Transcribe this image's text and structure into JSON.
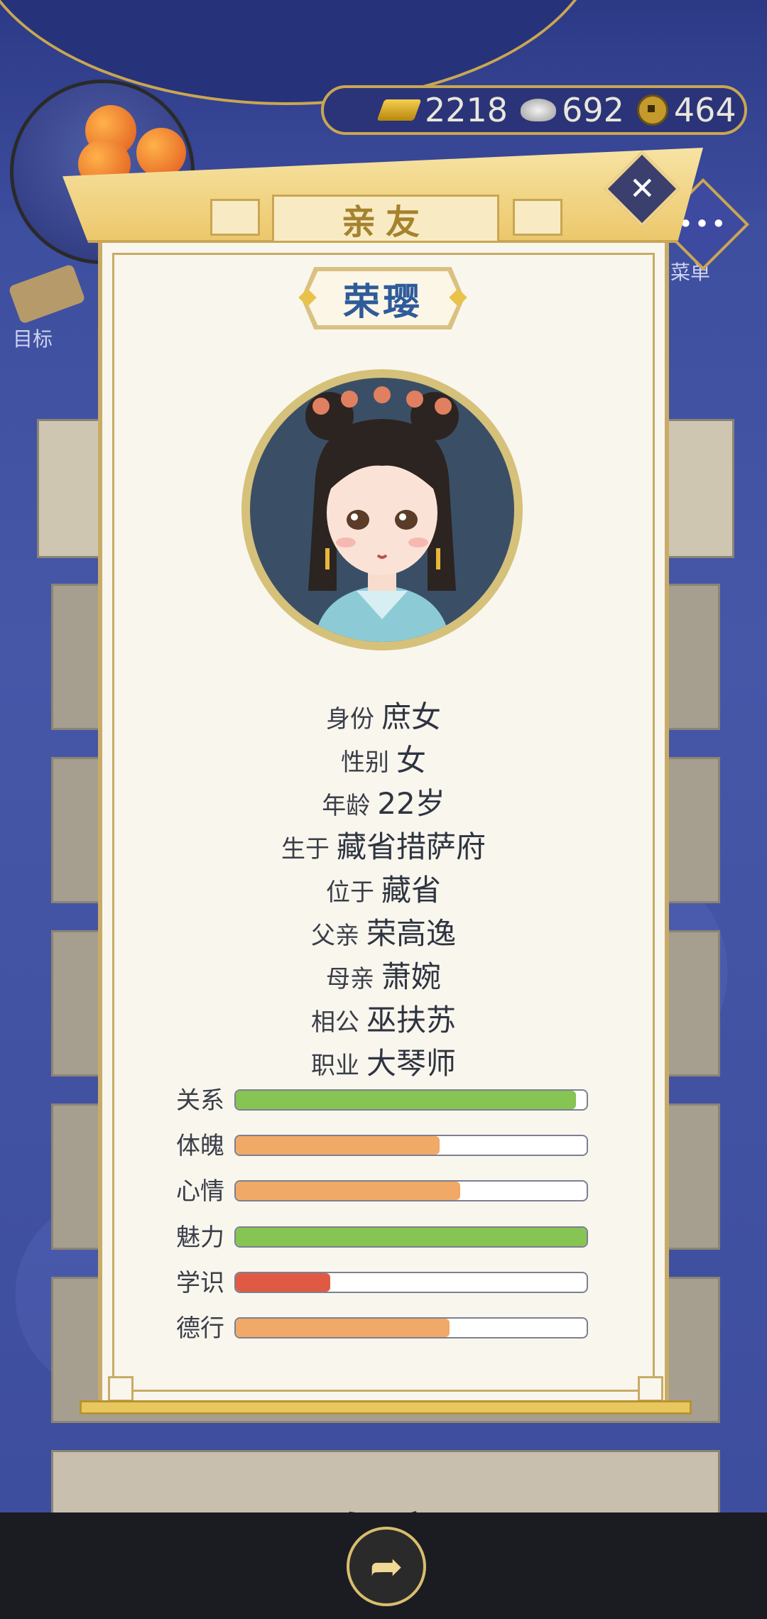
{
  "hud": {
    "gold": "2218",
    "silver": "692",
    "coins": "464",
    "target_label": "目标",
    "menu_label": "菜单"
  },
  "dialog": {
    "title": "亲友",
    "name": "荣璎",
    "info": [
      {
        "label": "身份",
        "value": "庶女"
      },
      {
        "label": "性别",
        "value": "女"
      },
      {
        "label": "年龄",
        "value": "22岁"
      },
      {
        "label": "生于",
        "value": "藏省措萨府"
      },
      {
        "label": "位于",
        "value": "藏省"
      },
      {
        "label": "父亲",
        "value": "荣高逸"
      },
      {
        "label": "母亲",
        "value": "萧婉"
      },
      {
        "label": "相公",
        "value": "巫扶苏"
      },
      {
        "label": "职业",
        "value": "大琴师"
      }
    ],
    "stats": [
      {
        "label": "关系",
        "fraction": 0.97,
        "color": "#86c453"
      },
      {
        "label": "体魄",
        "fraction": 0.58,
        "color": "#f0a967"
      },
      {
        "label": "心情",
        "fraction": 0.64,
        "color": "#f0a967"
      },
      {
        "label": "魅力",
        "fraction": 1.0,
        "color": "#86c453"
      },
      {
        "label": "学识",
        "fraction": 0.27,
        "color": "#e05a43"
      },
      {
        "label": "德行",
        "fraction": 0.61,
        "color": "#f0a967"
      }
    ]
  },
  "bottom": {
    "card_title": "欢离"
  },
  "colors": {
    "accent_gold": "#c9a652",
    "name_blue": "#2f5b9a",
    "bar_green": "#86c453",
    "bar_orange": "#f0a967",
    "bar_red": "#e05a43"
  },
  "icons": [
    "gold-ingot-icon",
    "silver-ingot-icon",
    "copper-coin-icon",
    "close-icon",
    "share-icon",
    "scroll-icon",
    "menu-icon"
  ]
}
